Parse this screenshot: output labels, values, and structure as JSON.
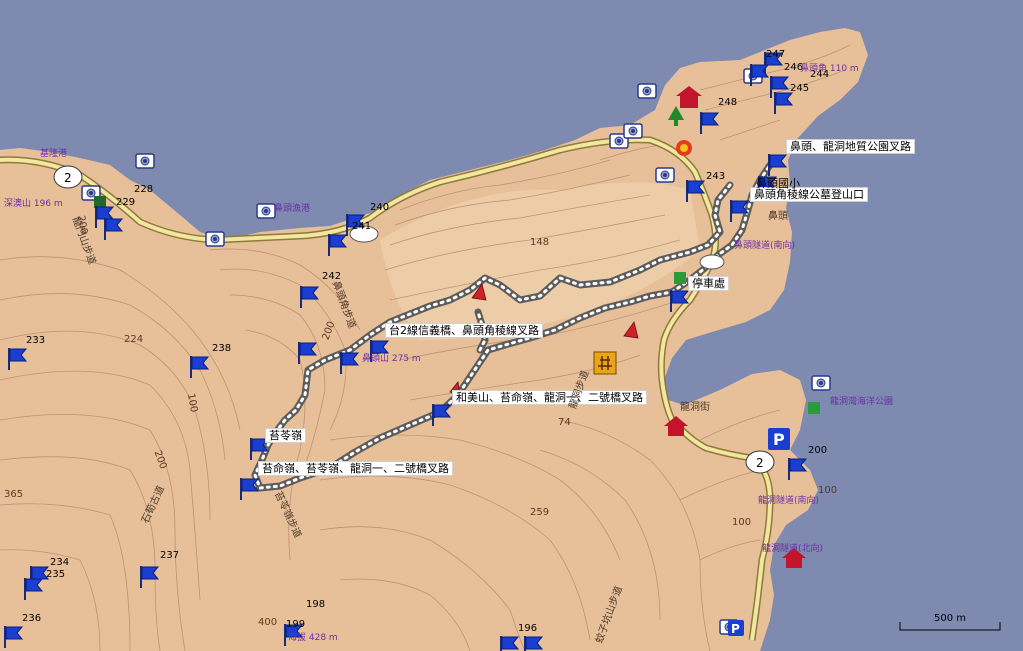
{
  "colors": {
    "sea": "#7e8ab0",
    "land": "#e7c09a",
    "land_light": "#efcfaa",
    "contour": "#b88a6a",
    "road": "#f2e7a0",
    "road_edge": "#8f7a3a",
    "track": "#5c5c5c",
    "track_dots": "#ffffff",
    "flag": "#1a3ecf",
    "poi_text": "#6b2fa3"
  },
  "callouts": {
    "c1": "鼻頭、龍洞地質公園叉路",
    "c2": "鼻頭角稜線公墓登山口",
    "c3": "停車處",
    "c4": "台2線信義橋、鼻頭角稜線叉路",
    "c5": "和美山、苔命嶺、龍洞一、二號橋叉路",
    "c6": "苔苓嶺",
    "c7": "苔命嶺、苔苓嶺、龍洞一、二號橋叉路",
    "c8": "鼻頭國小"
  },
  "waypoints": {
    "w228": "228",
    "w229": "229",
    "w233": "233",
    "w234": "234",
    "w235": "235",
    "w236": "236",
    "w237": "237",
    "w238": "238",
    "w240": "240",
    "w241": "241",
    "w242": "242",
    "w243": "243",
    "w244": "244",
    "w245": "245",
    "w246": "246",
    "w247": "247",
    "w248": "248",
    "w196": "196",
    "w198": "198",
    "w199": "199",
    "w200": "200"
  },
  "contours": {
    "k200a": "200",
    "k200b": "200",
    "k200c": "200",
    "k100a": "100",
    "k100b": "100",
    "k100c": "100",
    "k400": "400",
    "k365": "365",
    "k224": "224",
    "k148": "148",
    "k259": "259",
    "k74": "74"
  },
  "places": {
    "p_keelung": "基隆港",
    "p_shore": "鼻頭漁港",
    "p_bitou": "鼻頭",
    "p_longdong": "龍洞街",
    "p_hill275": "鼻頭山 275 m",
    "p_hill428": "海拔 428 m",
    "p_hill196": "196 m",
    "p_hill110": "鼻頭角 110 m",
    "p_park": "龍洞灣海洋公園",
    "p_bus1": "鼻頭隧道(南向)",
    "p_bus2": "龍洞隧道(南向)",
    "p_bus3": "龍洞隧道(北向)",
    "p_trail1": "鼻頭角步道",
    "p_trail2": "苔苓嶺步道",
    "p_trail3": "石筍古道",
    "p_trail4": "龍洞步道",
    "p_trail5": "蚊子坑山步道",
    "p_trail6": "龍門山步道",
    "p_hill_w": "深澳山 196 m"
  },
  "roads": {
    "r2a": "2",
    "r2b": "2"
  },
  "scale": {
    "label": "500 m"
  },
  "icons": {
    "camera": "camera-icon",
    "flag": "flag-icon",
    "temple": "temple-icon",
    "parking": "parking-icon",
    "trailhead": "trailhead-icon",
    "restaurant": "restaurant-icon"
  }
}
